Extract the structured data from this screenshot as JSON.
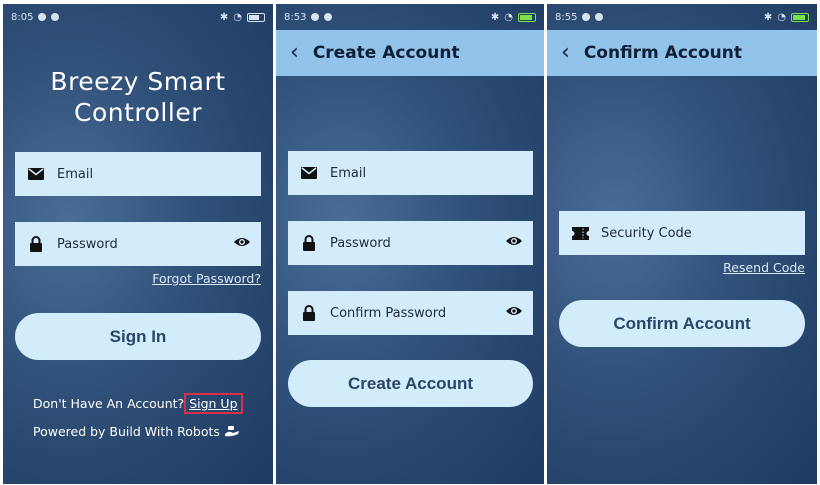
{
  "screen1": {
    "status_time": "8:05",
    "app_title_line1": "Breezy Smart",
    "app_title_line2": "Controller",
    "email_placeholder": "Email",
    "password_placeholder": "Password",
    "forgot_password": "Forgot Password?",
    "sign_in_label": "Sign In",
    "no_account_text": "Don't Have An Account?",
    "sign_up_link": "Sign Up",
    "powered_by": "Powered by Build With Robots"
  },
  "screen2": {
    "status_time": "8:53",
    "header_title": "Create Account",
    "email_placeholder": "Email",
    "password_placeholder": "Password",
    "confirm_password_placeholder": "Confirm Password",
    "create_account_label": "Create Account"
  },
  "screen3": {
    "status_time": "8:55",
    "header_title": "Confirm Account",
    "security_code_placeholder": "Security Code",
    "resend_code": "Resend Code",
    "confirm_account_label": "Confirm Account"
  },
  "colors": {
    "background_dark": "#1e3a62",
    "header_bar": "#92c3ea",
    "field_fill": "#d3ecfb",
    "button_text": "#2a4666",
    "highlight_border": "#d8304a"
  },
  "icons": [
    "back-arrow-icon",
    "mail-icon",
    "lock-icon",
    "eye-icon",
    "ticket-icon",
    "robot-hand-icon"
  ]
}
